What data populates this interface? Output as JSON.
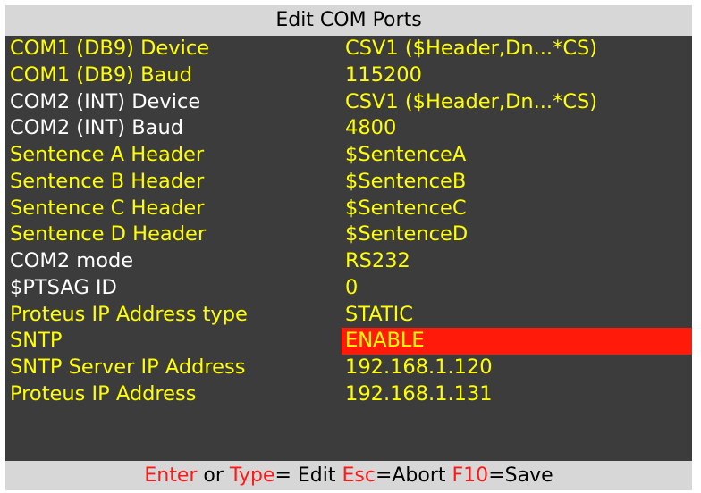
{
  "title": "Edit COM Ports",
  "colors": {
    "panel_background": "#3c3c3c",
    "active_text": "#ffff00",
    "inactive_text": "#ffffff",
    "selected_background": "#ff1a0a",
    "key_text": "#ff1a1a",
    "bar_background": "#d7d7d7"
  },
  "rows": [
    {
      "label": "COM1 (DB9) Device",
      "value": "CSV1 ($Header,Dn...*CS)",
      "label_color": "#ffff00",
      "value_color": "#ffff00",
      "selected": false
    },
    {
      "label": "COM1 (DB9) Baud",
      "value": "115200",
      "label_color": "#ffff00",
      "value_color": "#ffff00",
      "selected": false
    },
    {
      "label": "COM2 (INT) Device",
      "value": "CSV1 ($Header,Dn...*CS)",
      "label_color": "#ffffff",
      "value_color": "#ffff00",
      "selected": false
    },
    {
      "label": "COM2 (INT) Baud",
      "value": "4800",
      "label_color": "#ffffff",
      "value_color": "#ffff00",
      "selected": false
    },
    {
      "label": "Sentence A Header",
      "value": "$SentenceA",
      "label_color": "#ffff00",
      "value_color": "#ffff00",
      "selected": false
    },
    {
      "label": "Sentence B Header",
      "value": "$SentenceB",
      "label_color": "#ffff00",
      "value_color": "#ffff00",
      "selected": false
    },
    {
      "label": "Sentence C Header",
      "value": "$SentenceC",
      "label_color": "#ffff00",
      "value_color": "#ffff00",
      "selected": false
    },
    {
      "label": "Sentence D Header",
      "value": "$SentenceD",
      "label_color": "#ffff00",
      "value_color": "#ffff00",
      "selected": false
    },
    {
      "label": "COM2 mode",
      "value": "RS232",
      "label_color": "#ffffff",
      "value_color": "#ffff00",
      "selected": false
    },
    {
      "label": "$PTSAG ID",
      "value": "0",
      "label_color": "#ffffff",
      "value_color": "#ffff00",
      "selected": false
    },
    {
      "label": "Proteus IP Address type",
      "value": "STATIC",
      "label_color": "#ffff00",
      "value_color": "#ffff00",
      "selected": false
    },
    {
      "label": "SNTP",
      "value": "ENABLE",
      "label_color": "#ffff00",
      "value_color": "#ffff00",
      "selected": true
    },
    {
      "label": "SNTP Server IP Address",
      "value": "192.168.1.120",
      "label_color": "#ffff00",
      "value_color": "#ffff00",
      "selected": false
    },
    {
      "label": "Proteus IP Address",
      "value": "192.168.1.131",
      "label_color": "#ffff00",
      "value_color": "#ffff00",
      "selected": false
    }
  ],
  "footer": {
    "enter_key": "Enter",
    "or_text": " or ",
    "type_key": "Type",
    "edit_text": "= Edit ",
    "esc_key": "Esc",
    "abort_text": "=Abort ",
    "f10_key": "F10",
    "save_text": "=Save"
  }
}
